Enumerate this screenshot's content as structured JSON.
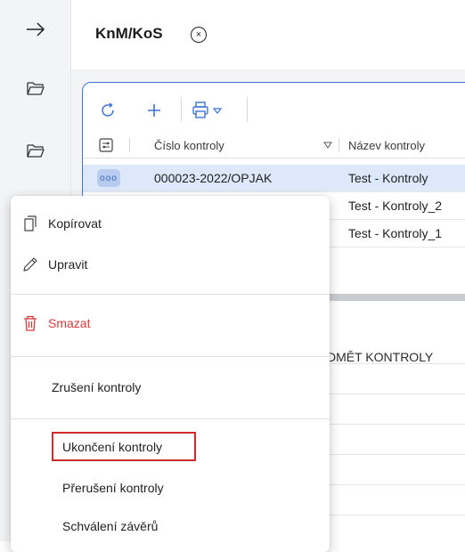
{
  "header": {
    "tab_title": "KnM/KoS",
    "tab_close": "×"
  },
  "grid": {
    "columns": [
      "Číslo kontroly",
      "Název kontroly"
    ],
    "rows": [
      {
        "number": "000023-2022/OPJAK",
        "name": "Test - Kontroly",
        "selected": true,
        "dots": "ooo"
      },
      {
        "number": "",
        "name": "Test - Kontroly_2",
        "selected": false
      },
      {
        "number": "",
        "name": "Test - Kontroly_1",
        "selected": false
      }
    ]
  },
  "lower": {
    "column_title": "DMĚT KONTROLY"
  },
  "menu": {
    "items": [
      {
        "label": "Kopírovat",
        "icon": "copy-icon"
      },
      {
        "label": "Upravit",
        "icon": "pencil-icon"
      },
      {
        "label": "Smazat",
        "icon": "trash-icon",
        "danger": true
      },
      {
        "label": "Zrušení kontroly"
      },
      {
        "label": "Ukončení kontroly",
        "highlighted": true
      },
      {
        "label": "Přerušení kontroly"
      },
      {
        "label": "Schválení závěrů"
      }
    ]
  },
  "colors": {
    "accent": "#3f73d6",
    "danger": "#d63a3a",
    "selected_row": "#dde9fb"
  }
}
